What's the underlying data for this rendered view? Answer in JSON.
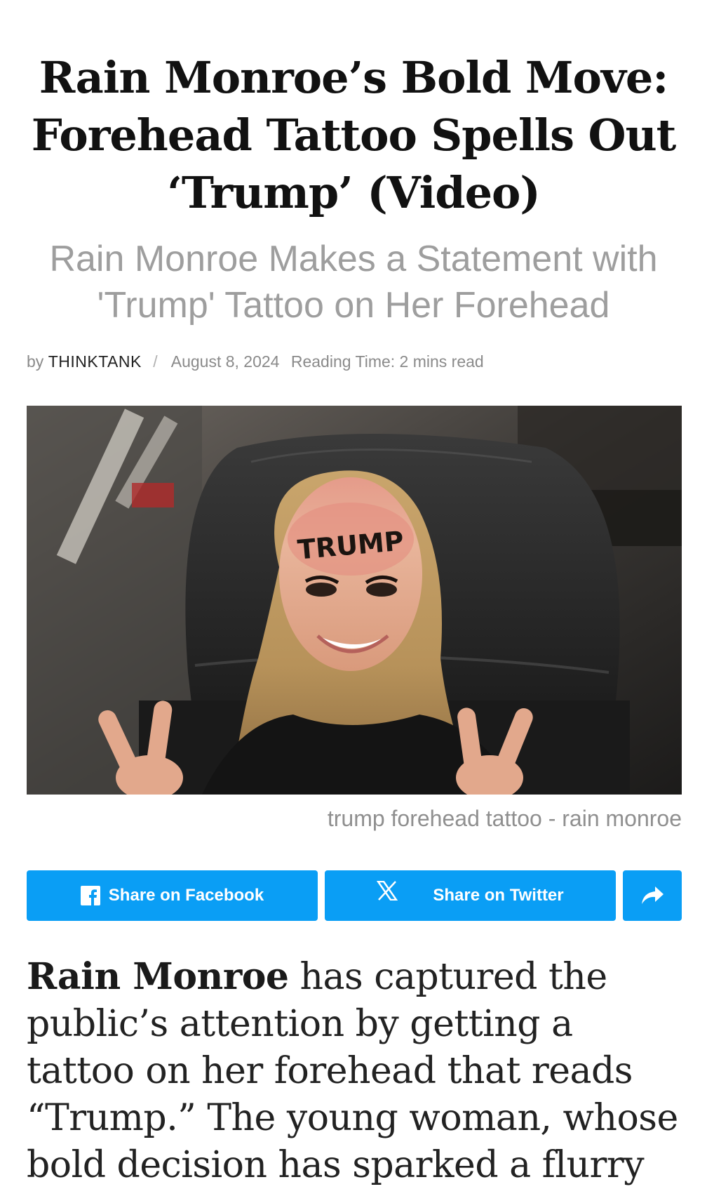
{
  "article": {
    "headline": "Rain Monroe’s Bold Move: Forehead Tattoo Spells Out ‘Trump’ (Video)",
    "subheadline": "Rain Monroe Makes a Statement with 'Trump' Tattoo on Her Forehead",
    "meta": {
      "by_label": "by",
      "author": "THINKTANK",
      "separator": "/",
      "date": "August 8, 2024",
      "reading_time": "Reading Time: 2 mins read"
    },
    "image": {
      "tattoo_text": "TRUMP",
      "caption": "trump forehead tattoo - rain monroe"
    },
    "share": {
      "facebook_label": "Share on Facebook",
      "facebook_icon": "facebook-icon",
      "twitter_label": "Share on Twitter",
      "twitter_icon": "x-icon",
      "more_icon": "share-arrow-icon",
      "button_color": "#0a9ef5"
    },
    "body": {
      "lead_bold": "Rain Monroe",
      "lead_rest": " has captured the public’s attention by getting a tattoo on her forehead that reads “Trump.” The young woman, whose bold decision has sparked a flurry"
    }
  }
}
